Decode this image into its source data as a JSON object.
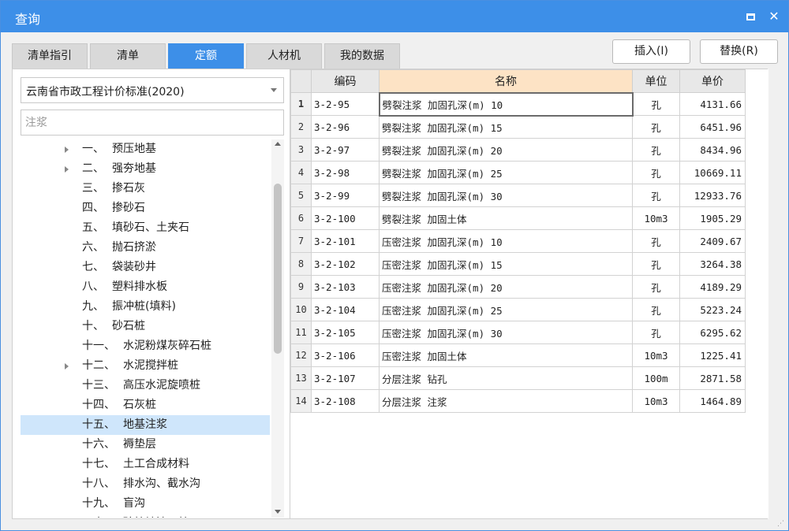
{
  "window": {
    "title": "查询"
  },
  "tabs": [
    {
      "label": "清单指引",
      "active": false
    },
    {
      "label": "清单",
      "active": false
    },
    {
      "label": "定额",
      "active": true
    },
    {
      "label": "人材机",
      "active": false
    },
    {
      "label": "我的数据",
      "active": false
    }
  ],
  "actions": {
    "insert_label": "插入(I)",
    "replace_label": "替换(R)"
  },
  "left": {
    "standard_select": "云南省市政工程计价标准(2020)",
    "search_value": "",
    "search_placeholder": "注浆",
    "tree": [
      {
        "num": "一、",
        "label": "预压地基",
        "expandable": true
      },
      {
        "num": "二、",
        "label": "强夯地基",
        "expandable": true
      },
      {
        "num": "三、",
        "label": "掺石灰",
        "expandable": false
      },
      {
        "num": "四、",
        "label": "掺砂石",
        "expandable": false
      },
      {
        "num": "五、",
        "label": "填砂石、土夹石",
        "expandable": false
      },
      {
        "num": "六、",
        "label": "抛石挤淤",
        "expandable": false
      },
      {
        "num": "七、",
        "label": "袋装砂井",
        "expandable": false
      },
      {
        "num": "八、",
        "label": "塑料排水板",
        "expandable": false
      },
      {
        "num": "九、",
        "label": "振冲桩(填料)",
        "expandable": false
      },
      {
        "num": "十、",
        "label": "砂石桩",
        "expandable": false
      },
      {
        "num": "十一、",
        "label": "水泥粉煤灰碎石桩",
        "expandable": false
      },
      {
        "num": "十二、",
        "label": "水泥搅拌桩",
        "expandable": true
      },
      {
        "num": "十三、",
        "label": "高压水泥旋喷桩",
        "expandable": false
      },
      {
        "num": "十四、",
        "label": "石灰桩",
        "expandable": false
      },
      {
        "num": "十五、",
        "label": "地基注浆",
        "expandable": false,
        "selected": true
      },
      {
        "num": "十六、",
        "label": "褥垫层",
        "expandable": false
      },
      {
        "num": "十七、",
        "label": "土工合成材料",
        "expandable": false
      },
      {
        "num": "十八、",
        "label": "排水沟、截水沟",
        "expandable": false
      },
      {
        "num": "十九、",
        "label": "盲沟",
        "expandable": false
      },
      {
        "num": "二十、",
        "label": "砼护坡渣、护面",
        "expandable": false
      }
    ]
  },
  "grid": {
    "headers": {
      "code": "编码",
      "name": "名称",
      "unit": "单位",
      "price": "单价"
    },
    "rows": [
      {
        "n": "1",
        "code": "3-2-95",
        "name": "劈裂注浆 加固孔深(m) 10",
        "unit": "孔",
        "price": "4131.66"
      },
      {
        "n": "2",
        "code": "3-2-96",
        "name": "劈裂注浆 加固孔深(m) 15",
        "unit": "孔",
        "price": "6451.96"
      },
      {
        "n": "3",
        "code": "3-2-97",
        "name": "劈裂注浆 加固孔深(m) 20",
        "unit": "孔",
        "price": "8434.96"
      },
      {
        "n": "4",
        "code": "3-2-98",
        "name": "劈裂注浆 加固孔深(m) 25",
        "unit": "孔",
        "price": "10669.11"
      },
      {
        "n": "5",
        "code": "3-2-99",
        "name": "劈裂注浆 加固孔深(m) 30",
        "unit": "孔",
        "price": "12933.76"
      },
      {
        "n": "6",
        "code": "3-2-100",
        "name": "劈裂注浆 加固土体",
        "unit": "10m3",
        "price": "1905.29"
      },
      {
        "n": "7",
        "code": "3-2-101",
        "name": "压密注浆 加固孔深(m) 10",
        "unit": "孔",
        "price": "2409.67"
      },
      {
        "n": "8",
        "code": "3-2-102",
        "name": "压密注浆 加固孔深(m) 15",
        "unit": "孔",
        "price": "3264.38"
      },
      {
        "n": "9",
        "code": "3-2-103",
        "name": "压密注浆 加固孔深(m) 20",
        "unit": "孔",
        "price": "4189.29"
      },
      {
        "n": "10",
        "code": "3-2-104",
        "name": "压密注浆 加固孔深(m) 25",
        "unit": "孔",
        "price": "5223.24"
      },
      {
        "n": "11",
        "code": "3-2-105",
        "name": "压密注浆 加固孔深(m) 30",
        "unit": "孔",
        "price": "6295.62"
      },
      {
        "n": "12",
        "code": "3-2-106",
        "name": "压密注浆 加固土体",
        "unit": "10m3",
        "price": "1225.41"
      },
      {
        "n": "13",
        "code": "3-2-107",
        "name": "分层注浆 钻孔",
        "unit": "100m",
        "price": "2871.58"
      },
      {
        "n": "14",
        "code": "3-2-108",
        "name": "分层注浆 注浆",
        "unit": "10m3",
        "price": "1464.89"
      }
    ]
  },
  "colors": {
    "accent": "#3d8fe8",
    "selected_row": "#cfe6fb",
    "header_highlight": "#fde3c5"
  }
}
